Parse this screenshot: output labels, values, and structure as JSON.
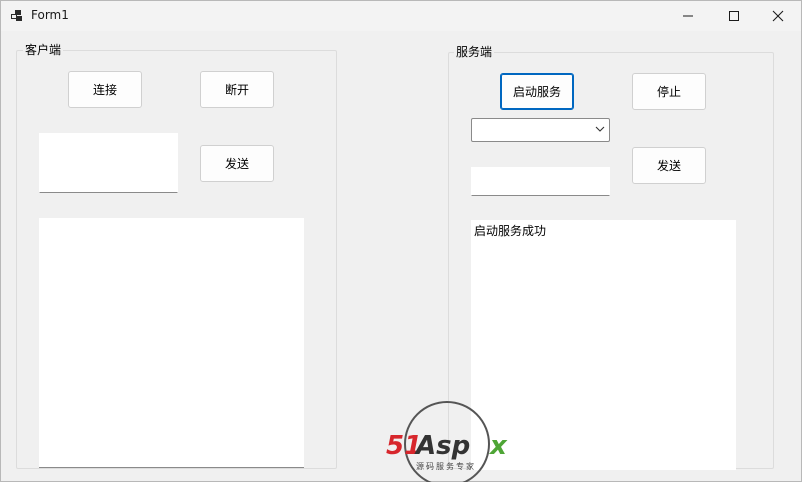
{
  "window": {
    "title": "Form1"
  },
  "client": {
    "group_label": "客户端",
    "connect_label": "连接",
    "disconnect_label": "断开",
    "send_label": "发送",
    "message_value": "",
    "log_text": ""
  },
  "server": {
    "group_label": "服务端",
    "start_label": "启动服务",
    "stop_label": "停止",
    "send_label": "发送",
    "client_select_value": "",
    "message_value": "",
    "log_text": "启动服务成功"
  },
  "watermark": {
    "brand": "51Aspx",
    "tagline": "源码服务专家"
  },
  "colors": {
    "focus_accent": "#0067c0",
    "brand_red": "#d7262c",
    "brand_green": "#4ea536"
  }
}
